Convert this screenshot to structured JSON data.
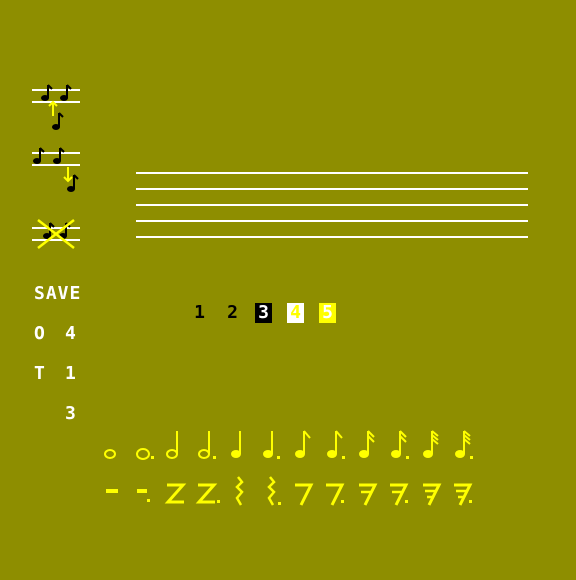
{
  "save_label": "SAVE",
  "octave": {
    "label": "O",
    "value": "4"
  },
  "tempo": {
    "label": "T",
    "value": "1"
  },
  "extra_value": "3",
  "tracks": [
    "1",
    "2",
    "3",
    "4",
    "5"
  ],
  "colors": {
    "background": "#8e8e00",
    "note_black": "#000000",
    "highlight": "#ffff00",
    "staff": "#ffffff"
  },
  "tools": [
    "shift-up-icon",
    "shift-down-icon",
    "delete-note-icon"
  ],
  "note_palette": [
    "whole-note",
    "dotted-whole-note",
    "half-note",
    "dotted-half-note",
    "quarter-note",
    "dotted-quarter-note",
    "eighth-note",
    "dotted-eighth-note",
    "sixteenth-note",
    "dotted-sixteenth-note",
    "thirty-second-note",
    "dotted-thirty-second-note"
  ],
  "rest_palette": [
    "whole-rest",
    "dotted-whole-rest",
    "half-rest",
    "dotted-half-rest",
    "quarter-rest",
    "dotted-quarter-rest",
    "eighth-rest",
    "dotted-eighth-rest",
    "sixteenth-rest",
    "dotted-sixteenth-rest",
    "thirty-second-rest",
    "dotted-thirty-second-rest"
  ]
}
